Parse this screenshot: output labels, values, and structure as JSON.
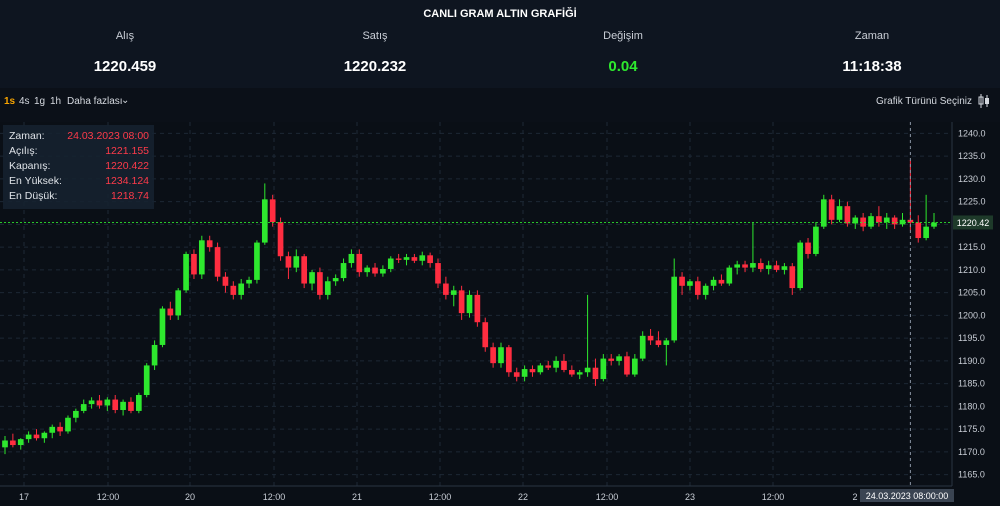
{
  "header": {
    "title": "CANLI GRAM ALTIN GRAFİĞİ",
    "stats": [
      {
        "label": "Alış",
        "value": "1220.459"
      },
      {
        "label": "Satış",
        "value": "1220.232"
      },
      {
        "label": "Değişim",
        "value": "0.04",
        "color": "#2ee82e"
      },
      {
        "label": "Zaman",
        "value": "11:18:38"
      }
    ]
  },
  "toolbar": {
    "timeframes": [
      "1s",
      "4s",
      "1g",
      "1h"
    ],
    "active": "1s",
    "more_label": "Daha fazlası",
    "chart_type_label": "Grafik Türünü Seçiniz"
  },
  "tooltip": {
    "rows": [
      {
        "key": "Zaman:",
        "value": "24.03.2023 08:00"
      },
      {
        "key": "Açılış:",
        "value": "1221.155"
      },
      {
        "key": "Kapanış:",
        "value": "1220.422"
      },
      {
        "key": "En Yüksek:",
        "value": "1234.124"
      },
      {
        "key": "En Düşük:",
        "value": "1218.74"
      }
    ]
  },
  "chart_data": {
    "type": "candlestick",
    "title": "CANLI GRAM ALTIN GRAFİĞİ",
    "y_ticks": [
      1165,
      1170,
      1175,
      1180,
      1185,
      1190,
      1195,
      1200,
      1205,
      1210,
      1215,
      1220,
      1225,
      1230,
      1235,
      1240
    ],
    "y_range": [
      1162.5,
      1242.5
    ],
    "x_tick_labels": [
      "17",
      "12:00",
      "20",
      "12:00",
      "21",
      "12:00",
      "22",
      "12:00",
      "23",
      "12:00",
      "24.03.2023  08:00:00"
    ],
    "last_price": "1220.42",
    "up_color": "#2ee82e",
    "down_color": "#ff2d40",
    "grid": true,
    "candles": [
      {
        "o": 1171.0,
        "h": 1173.5,
        "l": 1169.5,
        "c": 1172.5
      },
      {
        "o": 1172.5,
        "h": 1174.0,
        "l": 1171.0,
        "c": 1171.5
      },
      {
        "o": 1171.5,
        "h": 1173.0,
        "l": 1170.5,
        "c": 1172.8
      },
      {
        "o": 1172.8,
        "h": 1174.5,
        "l": 1172.0,
        "c": 1173.8
      },
      {
        "o": 1173.8,
        "h": 1175.0,
        "l": 1172.5,
        "c": 1173.0
      },
      {
        "o": 1173.0,
        "h": 1174.5,
        "l": 1172.0,
        "c": 1174.2
      },
      {
        "o": 1174.2,
        "h": 1176.0,
        "l": 1173.0,
        "c": 1175.5
      },
      {
        "o": 1175.5,
        "h": 1176.5,
        "l": 1173.5,
        "c": 1174.5
      },
      {
        "o": 1174.5,
        "h": 1178.0,
        "l": 1174.0,
        "c": 1177.5
      },
      {
        "o": 1177.5,
        "h": 1179.5,
        "l": 1176.5,
        "c": 1179.0
      },
      {
        "o": 1179.0,
        "h": 1181.5,
        "l": 1178.5,
        "c": 1180.5
      },
      {
        "o": 1180.5,
        "h": 1182.0,
        "l": 1179.5,
        "c": 1181.3
      },
      {
        "o": 1181.3,
        "h": 1182.5,
        "l": 1179.5,
        "c": 1180.2
      },
      {
        "o": 1180.2,
        "h": 1182.0,
        "l": 1179.0,
        "c": 1181.5
      },
      {
        "o": 1181.5,
        "h": 1182.5,
        "l": 1178.5,
        "c": 1179.2
      },
      {
        "o": 1179.2,
        "h": 1181.5,
        "l": 1178.0,
        "c": 1181.0
      },
      {
        "o": 1181.0,
        "h": 1182.0,
        "l": 1178.5,
        "c": 1179.0
      },
      {
        "o": 1179.0,
        "h": 1183.0,
        "l": 1178.5,
        "c": 1182.5
      },
      {
        "o": 1182.5,
        "h": 1189.5,
        "l": 1182.0,
        "c": 1189.0
      },
      {
        "o": 1189.0,
        "h": 1194.5,
        "l": 1188.0,
        "c": 1193.5
      },
      {
        "o": 1193.5,
        "h": 1202.0,
        "l": 1193.0,
        "c": 1201.5
      },
      {
        "o": 1201.5,
        "h": 1203.0,
        "l": 1199.0,
        "c": 1200.0
      },
      {
        "o": 1200.0,
        "h": 1206.0,
        "l": 1199.0,
        "c": 1205.5
      },
      {
        "o": 1205.5,
        "h": 1214.0,
        "l": 1205.0,
        "c": 1213.5
      },
      {
        "o": 1213.5,
        "h": 1214.5,
        "l": 1208.0,
        "c": 1209.0
      },
      {
        "o": 1209.0,
        "h": 1217.5,
        "l": 1208.0,
        "c": 1216.5
      },
      {
        "o": 1216.5,
        "h": 1217.5,
        "l": 1214.0,
        "c": 1215.0
      },
      {
        "o": 1215.0,
        "h": 1216.0,
        "l": 1207.5,
        "c": 1208.5
      },
      {
        "o": 1208.5,
        "h": 1209.5,
        "l": 1205.0,
        "c": 1206.5
      },
      {
        "o": 1206.5,
        "h": 1207.5,
        "l": 1203.5,
        "c": 1204.5
      },
      {
        "o": 1204.5,
        "h": 1208.0,
        "l": 1203.5,
        "c": 1207.0
      },
      {
        "o": 1207.0,
        "h": 1208.5,
        "l": 1206.0,
        "c": 1207.8
      },
      {
        "o": 1207.8,
        "h": 1216.5,
        "l": 1207.0,
        "c": 1216.0
      },
      {
        "o": 1216.0,
        "h": 1229.0,
        "l": 1215.5,
        "c": 1225.5
      },
      {
        "o": 1225.5,
        "h": 1226.5,
        "l": 1219.5,
        "c": 1220.5
      },
      {
        "o": 1220.5,
        "h": 1221.5,
        "l": 1212.0,
        "c": 1213.0
      },
      {
        "o": 1213.0,
        "h": 1214.0,
        "l": 1208.0,
        "c": 1210.5
      },
      {
        "o": 1210.5,
        "h": 1214.5,
        "l": 1209.5,
        "c": 1213.0
      },
      {
        "o": 1213.0,
        "h": 1213.5,
        "l": 1206.0,
        "c": 1207.0
      },
      {
        "o": 1207.0,
        "h": 1210.0,
        "l": 1205.5,
        "c": 1209.5
      },
      {
        "o": 1209.5,
        "h": 1210.5,
        "l": 1203.5,
        "c": 1204.5
      },
      {
        "o": 1204.5,
        "h": 1208.5,
        "l": 1203.5,
        "c": 1207.5
      },
      {
        "o": 1207.5,
        "h": 1209.0,
        "l": 1206.5,
        "c": 1208.2
      },
      {
        "o": 1208.2,
        "h": 1212.5,
        "l": 1207.5,
        "c": 1211.5
      },
      {
        "o": 1211.5,
        "h": 1214.5,
        "l": 1210.5,
        "c": 1213.5
      },
      {
        "o": 1213.5,
        "h": 1214.5,
        "l": 1208.5,
        "c": 1209.5
      },
      {
        "o": 1209.5,
        "h": 1211.0,
        "l": 1208.5,
        "c": 1210.5
      },
      {
        "o": 1210.5,
        "h": 1211.5,
        "l": 1208.5,
        "c": 1209.2
      },
      {
        "o": 1209.2,
        "h": 1211.0,
        "l": 1208.5,
        "c": 1210.2
      },
      {
        "o": 1210.2,
        "h": 1213.0,
        "l": 1209.5,
        "c": 1212.5
      },
      {
        "o": 1212.5,
        "h": 1213.5,
        "l": 1211.5,
        "c": 1212.2
      },
      {
        "o": 1212.2,
        "h": 1213.5,
        "l": 1211.0,
        "c": 1212.8
      },
      {
        "o": 1212.8,
        "h": 1213.5,
        "l": 1211.5,
        "c": 1212.0
      },
      {
        "o": 1212.0,
        "h": 1214.0,
        "l": 1211.0,
        "c": 1213.2
      },
      {
        "o": 1213.2,
        "h": 1213.8,
        "l": 1210.5,
        "c": 1211.5
      },
      {
        "o": 1211.5,
        "h": 1212.5,
        "l": 1206.0,
        "c": 1207.0
      },
      {
        "o": 1207.0,
        "h": 1208.5,
        "l": 1203.5,
        "c": 1204.5
      },
      {
        "o": 1204.5,
        "h": 1206.5,
        "l": 1202.0,
        "c": 1205.5
      },
      {
        "o": 1205.5,
        "h": 1206.5,
        "l": 1199.0,
        "c": 1200.5
      },
      {
        "o": 1200.5,
        "h": 1205.5,
        "l": 1199.5,
        "c": 1204.5
      },
      {
        "o": 1204.5,
        "h": 1205.5,
        "l": 1197.5,
        "c": 1198.5
      },
      {
        "o": 1198.5,
        "h": 1199.5,
        "l": 1192.0,
        "c": 1193.0
      },
      {
        "o": 1193.0,
        "h": 1194.0,
        "l": 1188.5,
        "c": 1189.5
      },
      {
        "o": 1189.5,
        "h": 1194.0,
        "l": 1188.5,
        "c": 1193.0
      },
      {
        "o": 1193.0,
        "h": 1193.5,
        "l": 1186.5,
        "c": 1187.5
      },
      {
        "o": 1187.5,
        "h": 1188.5,
        "l": 1185.5,
        "c": 1186.5
      },
      {
        "o": 1186.5,
        "h": 1189.0,
        "l": 1185.5,
        "c": 1188.2
      },
      {
        "o": 1188.2,
        "h": 1189.0,
        "l": 1186.5,
        "c": 1187.5
      },
      {
        "o": 1187.5,
        "h": 1189.5,
        "l": 1187.0,
        "c": 1189.0
      },
      {
        "o": 1189.0,
        "h": 1190.0,
        "l": 1188.0,
        "c": 1188.5
      },
      {
        "o": 1188.5,
        "h": 1191.0,
        "l": 1187.5,
        "c": 1190.0
      },
      {
        "o": 1190.0,
        "h": 1191.5,
        "l": 1187.5,
        "c": 1188.0
      },
      {
        "o": 1188.0,
        "h": 1189.0,
        "l": 1186.5,
        "c": 1187.0
      },
      {
        "o": 1187.0,
        "h": 1188.0,
        "l": 1186.0,
        "c": 1187.5
      },
      {
        "o": 1187.5,
        "h": 1204.5,
        "l": 1186.5,
        "c": 1188.5
      },
      {
        "o": 1188.5,
        "h": 1190.5,
        "l": 1184.5,
        "c": 1186.0
      },
      {
        "o": 1186.0,
        "h": 1191.5,
        "l": 1185.5,
        "c": 1190.5
      },
      {
        "o": 1190.5,
        "h": 1191.5,
        "l": 1189.0,
        "c": 1190.0
      },
      {
        "o": 1190.0,
        "h": 1191.5,
        "l": 1189.0,
        "c": 1191.0
      },
      {
        "o": 1191.0,
        "h": 1192.0,
        "l": 1186.5,
        "c": 1187.0
      },
      {
        "o": 1187.0,
        "h": 1191.5,
        "l": 1186.5,
        "c": 1190.5
      },
      {
        "o": 1190.5,
        "h": 1196.5,
        "l": 1190.0,
        "c": 1195.5
      },
      {
        "o": 1195.5,
        "h": 1197.0,
        "l": 1193.5,
        "c": 1194.5
      },
      {
        "o": 1194.5,
        "h": 1196.5,
        "l": 1193.0,
        "c": 1193.5
      },
      {
        "o": 1193.5,
        "h": 1195.0,
        "l": 1189.0,
        "c": 1194.5
      },
      {
        "o": 1194.5,
        "h": 1212.5,
        "l": 1194.0,
        "c": 1208.5
      },
      {
        "o": 1208.5,
        "h": 1209.5,
        "l": 1204.5,
        "c": 1206.5
      },
      {
        "o": 1206.5,
        "h": 1208.0,
        "l": 1205.5,
        "c": 1207.5
      },
      {
        "o": 1207.5,
        "h": 1208.5,
        "l": 1203.5,
        "c": 1204.5
      },
      {
        "o": 1204.5,
        "h": 1207.0,
        "l": 1203.5,
        "c": 1206.5
      },
      {
        "o": 1206.5,
        "h": 1208.5,
        "l": 1205.5,
        "c": 1207.8
      },
      {
        "o": 1207.8,
        "h": 1209.0,
        "l": 1206.5,
        "c": 1207.0
      },
      {
        "o": 1207.0,
        "h": 1211.0,
        "l": 1206.5,
        "c": 1210.5
      },
      {
        "o": 1210.5,
        "h": 1212.0,
        "l": 1209.0,
        "c": 1211.2
      },
      {
        "o": 1211.2,
        "h": 1212.0,
        "l": 1209.5,
        "c": 1210.5
      },
      {
        "o": 1210.5,
        "h": 1220.5,
        "l": 1209.5,
        "c": 1211.5
      },
      {
        "o": 1211.5,
        "h": 1212.5,
        "l": 1209.5,
        "c": 1210.2
      },
      {
        "o": 1210.2,
        "h": 1212.0,
        "l": 1209.0,
        "c": 1211.0
      },
      {
        "o": 1211.0,
        "h": 1212.0,
        "l": 1209.5,
        "c": 1210.0
      },
      {
        "o": 1210.0,
        "h": 1211.5,
        "l": 1209.0,
        "c": 1210.8
      },
      {
        "o": 1210.8,
        "h": 1211.5,
        "l": 1204.5,
        "c": 1206.0
      },
      {
        "o": 1206.0,
        "h": 1216.5,
        "l": 1205.5,
        "c": 1216.0
      },
      {
        "o": 1216.0,
        "h": 1217.0,
        "l": 1212.5,
        "c": 1213.5
      },
      {
        "o": 1213.5,
        "h": 1220.5,
        "l": 1213.0,
        "c": 1219.5
      },
      {
        "o": 1219.5,
        "h": 1226.5,
        "l": 1219.0,
        "c": 1225.5
      },
      {
        "o": 1225.5,
        "h": 1226.5,
        "l": 1220.0,
        "c": 1221.0
      },
      {
        "o": 1221.0,
        "h": 1225.5,
        "l": 1220.5,
        "c": 1224.0
      },
      {
        "o": 1224.0,
        "h": 1225.0,
        "l": 1219.5,
        "c": 1220.2
      },
      {
        "o": 1220.2,
        "h": 1222.0,
        "l": 1219.0,
        "c": 1221.5
      },
      {
        "o": 1221.5,
        "h": 1222.5,
        "l": 1218.5,
        "c": 1219.5
      },
      {
        "o": 1219.5,
        "h": 1222.5,
        "l": 1219.0,
        "c": 1221.8
      },
      {
        "o": 1221.8,
        "h": 1224.0,
        "l": 1219.5,
        "c": 1220.5
      },
      {
        "o": 1220.5,
        "h": 1222.5,
        "l": 1219.0,
        "c": 1221.5
      },
      {
        "o": 1221.5,
        "h": 1222.0,
        "l": 1219.0,
        "c": 1220.0
      },
      {
        "o": 1220.0,
        "h": 1222.5,
        "l": 1219.5,
        "c": 1221.0
      },
      {
        "o": 1221.0,
        "h": 1234.1,
        "l": 1218.7,
        "c": 1220.4
      },
      {
        "o": 1220.4,
        "h": 1222.0,
        "l": 1216.0,
        "c": 1217.0
      },
      {
        "o": 1217.0,
        "h": 1226.5,
        "l": 1216.5,
        "c": 1219.5
      },
      {
        "o": 1219.5,
        "h": 1222.5,
        "l": 1219.0,
        "c": 1220.4
      }
    ]
  }
}
